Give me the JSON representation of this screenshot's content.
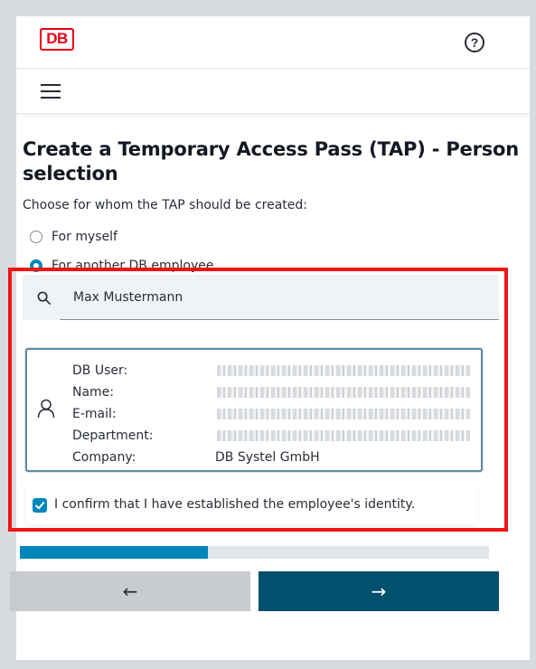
{
  "header": {
    "logo_text": "DB",
    "help_icon": "question-mark-circle-icon",
    "menu_icon": "hamburger-menu-icon"
  },
  "page": {
    "title": "Create a Temporary Access Pass (TAP) - Person selection",
    "subtitle": "Choose for whom the TAP should be created:"
  },
  "options": [
    {
      "label": "For myself",
      "selected": false
    },
    {
      "label": "For another DB employee",
      "selected": true
    }
  ],
  "search": {
    "icon": "search-icon",
    "value": "Max Mustermann"
  },
  "person_card": {
    "icon": "person-icon",
    "fields": [
      {
        "label": "DB User:",
        "value": "",
        "redacted": true
      },
      {
        "label": "Name:",
        "value": "",
        "redacted": true
      },
      {
        "label": "E-mail:",
        "value": "",
        "redacted": true
      },
      {
        "label": "Department:",
        "value": "",
        "redacted": true
      },
      {
        "label": "Company:",
        "value": "DB Systel GmbH",
        "redacted": false
      }
    ]
  },
  "confirm": {
    "checked": true,
    "label": "I confirm that I have established the employee's identity."
  },
  "progress": {
    "fraction": 0.4
  },
  "buttons": {
    "back_label": "←",
    "next_label": "→"
  },
  "colors": {
    "brand_red": "#ec0016",
    "accent_blue": "#0087b9",
    "primary_dark": "#00506e",
    "highlight_red": "#f01414"
  }
}
